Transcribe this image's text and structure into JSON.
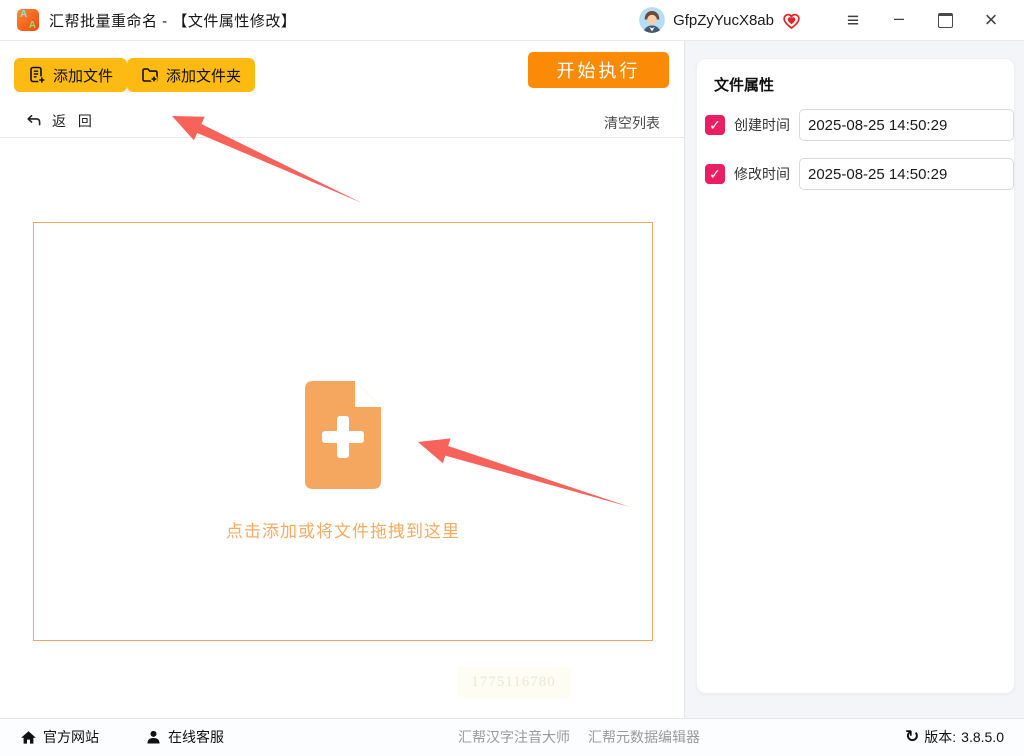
{
  "window": {
    "title": "汇帮批量重命名 - 【文件属性修改】",
    "username": "GfpZyYucX8ab"
  },
  "icons": {
    "menu": "≡",
    "minimize": "–",
    "close": "×",
    "check": "✓",
    "sync": "↻"
  },
  "toolbar": {
    "add_files_label": "添加文件",
    "add_folder_label": "添加文件夹",
    "start_label": "开始执行"
  },
  "list_bar": {
    "back_label": "返 回",
    "clear_label": "清空列表"
  },
  "dropzone": {
    "hint": "点击添加或将文件拖拽到这里",
    "watermark": "1775116780"
  },
  "panel": {
    "title": "文件属性",
    "rows": [
      {
        "label": "创建时间",
        "checked": true,
        "value": "2025-08-25 14:50:29"
      },
      {
        "label": "修改时间",
        "checked": true,
        "value": "2025-08-25 14:50:29"
      }
    ]
  },
  "statusbar": {
    "official_label": "官方网站",
    "support_label": "在线客服",
    "link_pinyin": "汇帮汉字注音大师",
    "link_metadata": "汇帮元数据编辑器",
    "version_label": "版本:",
    "version_value": "3.8.5.0"
  },
  "colors": {
    "accent_yellow": "#fcba12",
    "accent_orange": "#fb8b06",
    "drop_orange": "#f2a75f",
    "checkbox_pink": "#e91e63",
    "arrow_red": "#f7625b"
  }
}
